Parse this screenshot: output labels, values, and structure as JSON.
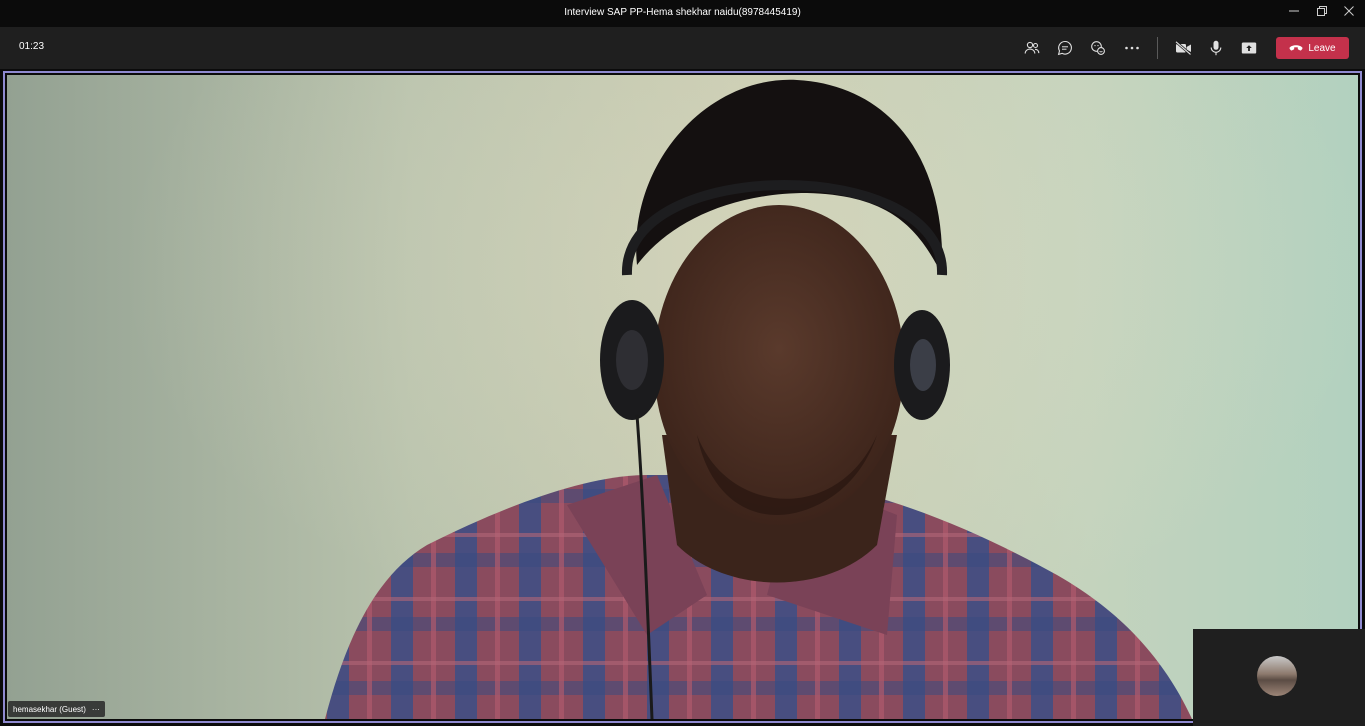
{
  "window": {
    "title": "Interview SAP PP-Hema shekhar naidu(8978445419)",
    "controls": [
      "minimize-icon",
      "restore-icon",
      "close-icon"
    ]
  },
  "toolbar": {
    "timer": "01:23",
    "buttons": [
      "participants-icon",
      "chat-icon",
      "reactions-icon",
      "more-options-icon",
      "camera-off-icon",
      "microphone-icon",
      "share-screen-icon"
    ],
    "leave_label": "Leave"
  },
  "stage": {
    "participant_name": "hemasekhar (Guest)",
    "name_tag_more": "···"
  },
  "colors": {
    "leave": "#c4314b",
    "active_speaker_border": "#8f8ad0",
    "toolbar": "#1f1f1f"
  }
}
